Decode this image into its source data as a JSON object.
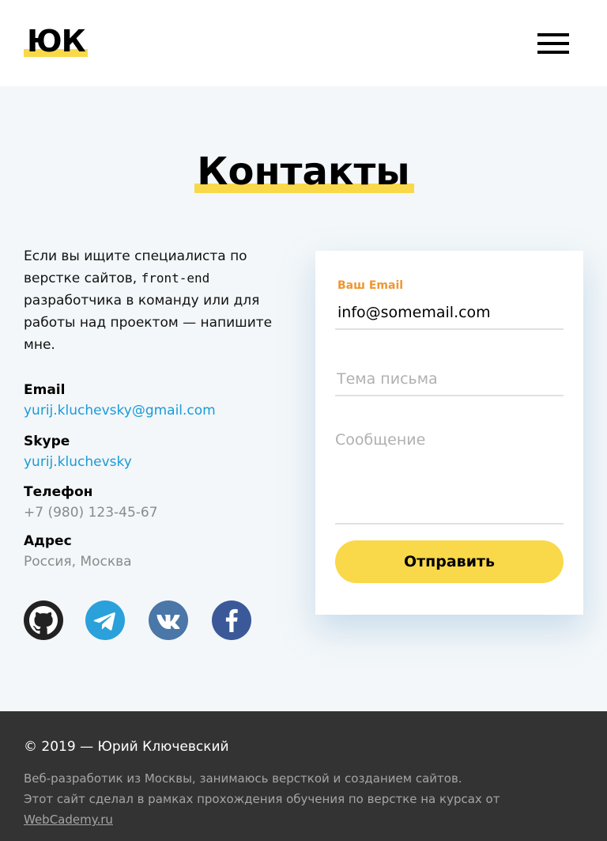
{
  "header": {
    "logo": "ЮК",
    "menu_icon": "hamburger-menu-icon"
  },
  "page": {
    "title": "Контакты"
  },
  "intro": {
    "text_before": "Если вы ищите специалиста по верстке сайтов, ",
    "code": "front-end",
    "text_after": " разработчика в команду или для работы над проектом — напишите мне."
  },
  "contacts": {
    "email_label": "Email",
    "email_value": "yurij.kluchevsky@gmail.com",
    "skype_label": "Skype",
    "skype_value": "yurij.kluchevsky",
    "phone_label": "Телефон",
    "phone_value": "+7 (980) 123-45-67",
    "address_label": "Адрес",
    "address_value": "Россия, Москва"
  },
  "social": {
    "icons": [
      "github-icon",
      "telegram-icon",
      "vk-icon",
      "facebook-icon"
    ],
    "colors": {
      "github": "#222222",
      "telegram": "#2aa1da",
      "vk": "#4a76a8",
      "facebook": "#3b5998"
    }
  },
  "form": {
    "email_label": "Ваш Email",
    "email_value": "info@somemail.com",
    "subject_placeholder": "Тема письма",
    "message_placeholder": "Сообщение",
    "submit_label": "Отправить"
  },
  "footer": {
    "copyright": "© 2019 — Юрий Ключевский",
    "line1": "Веб-разработик из Москвы, занимаюсь версткой и созданием сайтов.",
    "line2_text": "Этот сайт сделал в рамках прохождения обучения по верстке на курсах от ",
    "line2_link": "WebCademy.ru"
  },
  "colors": {
    "accent_yellow": "#f9d94a",
    "link_blue": "#1a9ad9",
    "label_orange": "#f0962e",
    "footer_bg": "#333333"
  }
}
